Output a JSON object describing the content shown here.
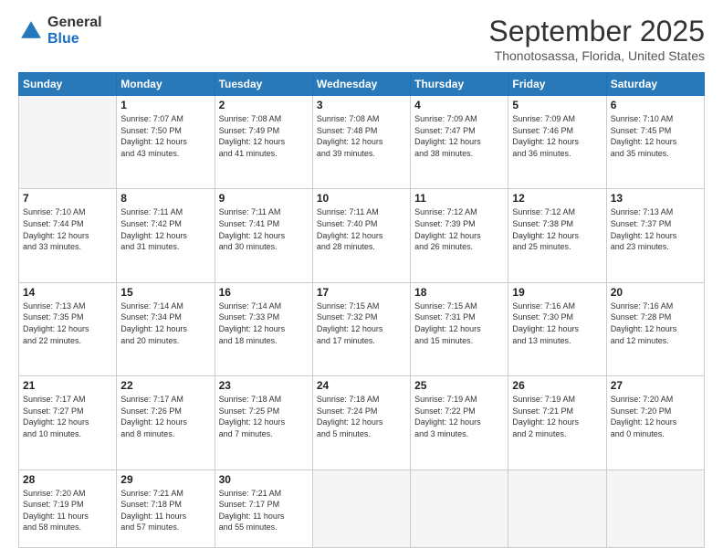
{
  "logo": {
    "line1": "General",
    "line2": "Blue"
  },
  "header": {
    "month": "September 2025",
    "location": "Thonotosassa, Florida, United States"
  },
  "weekdays": [
    "Sunday",
    "Monday",
    "Tuesday",
    "Wednesday",
    "Thursday",
    "Friday",
    "Saturday"
  ],
  "weeks": [
    [
      {
        "day": "",
        "info": ""
      },
      {
        "day": "1",
        "info": "Sunrise: 7:07 AM\nSunset: 7:50 PM\nDaylight: 12 hours\nand 43 minutes."
      },
      {
        "day": "2",
        "info": "Sunrise: 7:08 AM\nSunset: 7:49 PM\nDaylight: 12 hours\nand 41 minutes."
      },
      {
        "day": "3",
        "info": "Sunrise: 7:08 AM\nSunset: 7:48 PM\nDaylight: 12 hours\nand 39 minutes."
      },
      {
        "day": "4",
        "info": "Sunrise: 7:09 AM\nSunset: 7:47 PM\nDaylight: 12 hours\nand 38 minutes."
      },
      {
        "day": "5",
        "info": "Sunrise: 7:09 AM\nSunset: 7:46 PM\nDaylight: 12 hours\nand 36 minutes."
      },
      {
        "day": "6",
        "info": "Sunrise: 7:10 AM\nSunset: 7:45 PM\nDaylight: 12 hours\nand 35 minutes."
      }
    ],
    [
      {
        "day": "7",
        "info": "Sunrise: 7:10 AM\nSunset: 7:44 PM\nDaylight: 12 hours\nand 33 minutes."
      },
      {
        "day": "8",
        "info": "Sunrise: 7:11 AM\nSunset: 7:42 PM\nDaylight: 12 hours\nand 31 minutes."
      },
      {
        "day": "9",
        "info": "Sunrise: 7:11 AM\nSunset: 7:41 PM\nDaylight: 12 hours\nand 30 minutes."
      },
      {
        "day": "10",
        "info": "Sunrise: 7:11 AM\nSunset: 7:40 PM\nDaylight: 12 hours\nand 28 minutes."
      },
      {
        "day": "11",
        "info": "Sunrise: 7:12 AM\nSunset: 7:39 PM\nDaylight: 12 hours\nand 26 minutes."
      },
      {
        "day": "12",
        "info": "Sunrise: 7:12 AM\nSunset: 7:38 PM\nDaylight: 12 hours\nand 25 minutes."
      },
      {
        "day": "13",
        "info": "Sunrise: 7:13 AM\nSunset: 7:37 PM\nDaylight: 12 hours\nand 23 minutes."
      }
    ],
    [
      {
        "day": "14",
        "info": "Sunrise: 7:13 AM\nSunset: 7:35 PM\nDaylight: 12 hours\nand 22 minutes."
      },
      {
        "day": "15",
        "info": "Sunrise: 7:14 AM\nSunset: 7:34 PM\nDaylight: 12 hours\nand 20 minutes."
      },
      {
        "day": "16",
        "info": "Sunrise: 7:14 AM\nSunset: 7:33 PM\nDaylight: 12 hours\nand 18 minutes."
      },
      {
        "day": "17",
        "info": "Sunrise: 7:15 AM\nSunset: 7:32 PM\nDaylight: 12 hours\nand 17 minutes."
      },
      {
        "day": "18",
        "info": "Sunrise: 7:15 AM\nSunset: 7:31 PM\nDaylight: 12 hours\nand 15 minutes."
      },
      {
        "day": "19",
        "info": "Sunrise: 7:16 AM\nSunset: 7:30 PM\nDaylight: 12 hours\nand 13 minutes."
      },
      {
        "day": "20",
        "info": "Sunrise: 7:16 AM\nSunset: 7:28 PM\nDaylight: 12 hours\nand 12 minutes."
      }
    ],
    [
      {
        "day": "21",
        "info": "Sunrise: 7:17 AM\nSunset: 7:27 PM\nDaylight: 12 hours\nand 10 minutes."
      },
      {
        "day": "22",
        "info": "Sunrise: 7:17 AM\nSunset: 7:26 PM\nDaylight: 12 hours\nand 8 minutes."
      },
      {
        "day": "23",
        "info": "Sunrise: 7:18 AM\nSunset: 7:25 PM\nDaylight: 12 hours\nand 7 minutes."
      },
      {
        "day": "24",
        "info": "Sunrise: 7:18 AM\nSunset: 7:24 PM\nDaylight: 12 hours\nand 5 minutes."
      },
      {
        "day": "25",
        "info": "Sunrise: 7:19 AM\nSunset: 7:22 PM\nDaylight: 12 hours\nand 3 minutes."
      },
      {
        "day": "26",
        "info": "Sunrise: 7:19 AM\nSunset: 7:21 PM\nDaylight: 12 hours\nand 2 minutes."
      },
      {
        "day": "27",
        "info": "Sunrise: 7:20 AM\nSunset: 7:20 PM\nDaylight: 12 hours\nand 0 minutes."
      }
    ],
    [
      {
        "day": "28",
        "info": "Sunrise: 7:20 AM\nSunset: 7:19 PM\nDaylight: 11 hours\nand 58 minutes."
      },
      {
        "day": "29",
        "info": "Sunrise: 7:21 AM\nSunset: 7:18 PM\nDaylight: 11 hours\nand 57 minutes."
      },
      {
        "day": "30",
        "info": "Sunrise: 7:21 AM\nSunset: 7:17 PM\nDaylight: 11 hours\nand 55 minutes."
      },
      {
        "day": "",
        "info": ""
      },
      {
        "day": "",
        "info": ""
      },
      {
        "day": "",
        "info": ""
      },
      {
        "day": "",
        "info": ""
      }
    ]
  ]
}
